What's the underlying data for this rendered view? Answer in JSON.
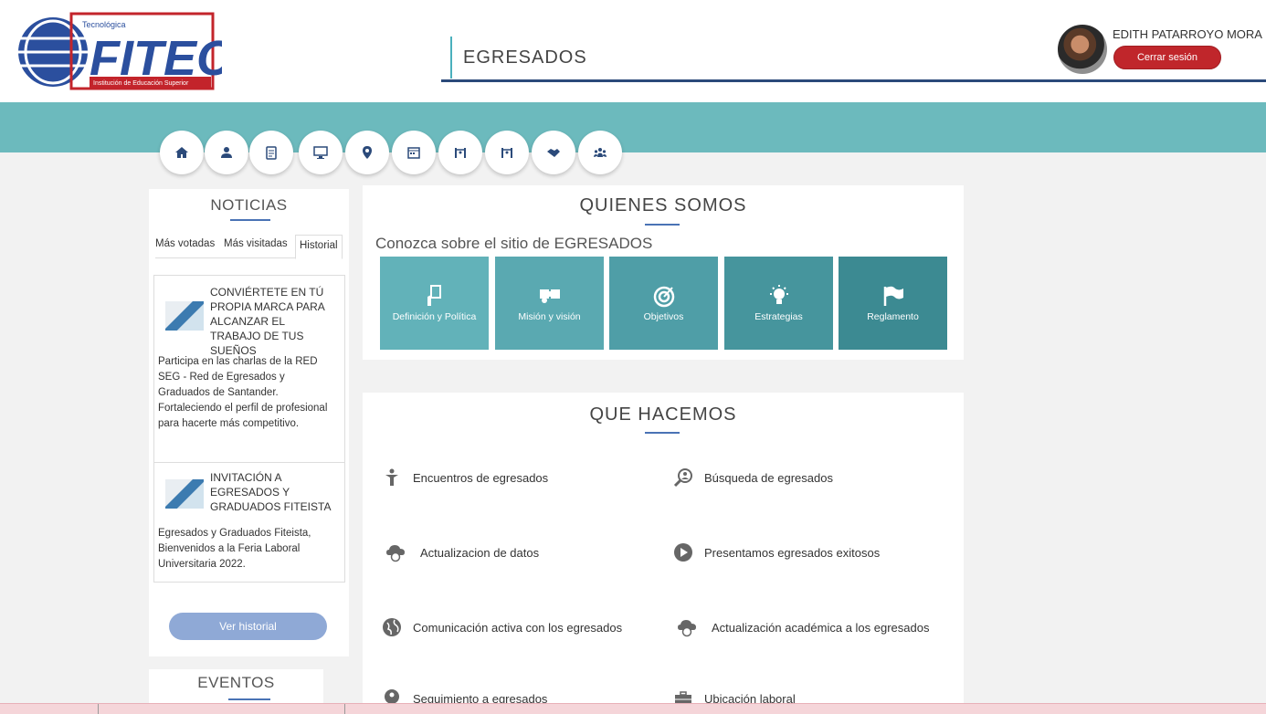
{
  "header": {
    "logo": {
      "top_text": "Tecnológica",
      "brand": "FITEC",
      "sub_text": "Institución de Educación Superior"
    },
    "title": "EGRESADOS",
    "user_name": "EDITH PATARROYO MORA",
    "logout_label": "Cerrar sesión"
  },
  "nav_icons": [
    "home-icon",
    "user-icon",
    "clipboard-icon",
    "monitor-icon",
    "location-icon",
    "calendar-icon",
    "parallel-bars-icon",
    "parallel-bars-icon",
    "handshake-icon",
    "group-icon"
  ],
  "news": {
    "heading": "NOTICIAS",
    "tabs": [
      {
        "label": "Más votadas",
        "active": false
      },
      {
        "label": "Más visitadas",
        "active": false
      },
      {
        "label": "Historial",
        "active": true
      }
    ],
    "items": [
      {
        "title": "CONVIÉRTETE EN TÚ PROPIA MARCA PARA ALCANZAR EL TRABAJO DE TUS SUEÑOS",
        "body": "Participa en las charlas de la RED SEG - Red de Egresados y Graduados de Santander. Fortaleciendo el perfil de profesional para hacerte más competitivo."
      },
      {
        "title": "INVITACIÓN A EGRESADOS Y GRADUADOS FITEISTA",
        "body": "Egresados y Graduados Fiteista, Bienvenidos a la Feria Laboral Universitaria 2022."
      }
    ],
    "more_button": "Ver historial"
  },
  "events": {
    "heading": "EVENTOS"
  },
  "quienes_somos": {
    "heading": "QUIENES SOMOS",
    "subtitle": "Conozca sobre el sitio de EGRESADOS",
    "tiles": [
      {
        "label": "Definición y Política",
        "icon": "document-hand-icon",
        "color": "#62b2b9"
      },
      {
        "label": "Misión y visión",
        "icon": "puzzle-icon",
        "color": "#5aa9b1"
      },
      {
        "label": "Objetivos",
        "icon": "target-icon",
        "color": "#4f9ea7"
      },
      {
        "label": "Estrategias",
        "icon": "lightbulb-icon",
        "color": "#46959d"
      },
      {
        "label": "Reglamento",
        "icon": "flag-icon",
        "color": "#3c8a92"
      }
    ]
  },
  "que_hacemos": {
    "heading": "QUE HACEMOS",
    "items": [
      {
        "label": "Encuentros de egresados",
        "icon": "person-icon"
      },
      {
        "label": "Búsqueda de egresados",
        "icon": "search-person-icon"
      },
      {
        "label": "Actualizacion de datos",
        "icon": "cloud-sync-icon"
      },
      {
        "label": "Presentamos egresados exitosos",
        "icon": "play-icon"
      },
      {
        "label": "Comunicación activa con los egresados",
        "icon": "globe-icon"
      },
      {
        "label": "Actualización académica a los egresados",
        "icon": "cloud-sync-icon"
      },
      {
        "label": "Seguimiento a egresados",
        "icon": "search-person-icon"
      },
      {
        "label": "Ubicación laboral",
        "icon": "briefcase-icon"
      }
    ]
  }
}
